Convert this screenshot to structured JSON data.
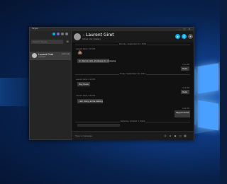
{
  "window": {
    "title": "Skype"
  },
  "sidebar": {
    "search_placeholder": "Search Skype",
    "conversations": [
      {
        "name": "Laurent Giret",
        "preview": "Laurent",
        "time": "Just now"
      }
    ]
  },
  "chat": {
    "contact_name": "Laurent Giret",
    "status": "Active now | Gallery",
    "separators": [
      "Monday, September 12, 2016",
      "Friday, September 16, 2016",
      "Saturday, October 1, 2016"
    ],
    "messages": [
      {
        "meta": "Laurent Giret, 7:05 PM",
        "text": "",
        "emoji": "💩"
      },
      {
        "meta": "",
        "text": "Un blame liste whatsapp de charging"
      },
      {
        "meta": "7:51 PM",
        "text": "Hello",
        "side": "right"
      },
      {
        "meta": "Laurent Giret, 3:10 PM",
        "text": "Hey there"
      },
      {
        "meta": "3:12 PM",
        "text": "Hello",
        "side": "right"
      },
      {
        "meta": "Laurent Giret, 4:03 PM",
        "text": "I am doing some testing"
      },
      {
        "meta": "4:04 PM",
        "text": "Skype Insider",
        "side": "right"
      }
    ]
  },
  "composer": {
    "placeholder": "Type a message"
  },
  "colors": {
    "accent": "#00aff0",
    "desktop": "#0f3c86"
  }
}
